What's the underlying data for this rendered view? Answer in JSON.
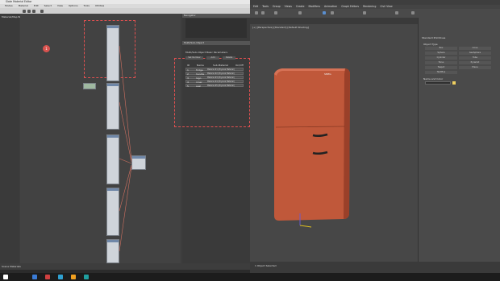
{
  "window": {
    "title": "Slate Material Editor",
    "max_title": "Untitled - Autodesk 3ds Max"
  },
  "sme_menu": [
    "Modes",
    "Material",
    "Edit",
    "Select",
    "View",
    "Options",
    "Tools",
    "Utilities"
  ],
  "max_menu": [
    "Edit",
    "Tools",
    "Group",
    "Views",
    "Create",
    "Modifiers",
    "Animation",
    "Graph Editors",
    "Rendering",
    "Civil View",
    "Customize",
    "Scripting",
    "Content",
    "Arnold",
    "Help"
  ],
  "panels": {
    "navigator": "Navigator",
    "params_title": "Multi/Sub-Object",
    "multisub": "Multi/Sub-Object Basic Parameters",
    "set_number": "Set Number",
    "add": "Add",
    "delete": "Delete",
    "cols": [
      "ID",
      "Name",
      "Sub-Material",
      "On/Off"
    ],
    "rows": [
      {
        "id": "1",
        "name": "fridge",
        "mat": "Material #1 (Physical Material)"
      },
      {
        "id": "2",
        "name": "handle",
        "mat": "Material #2 (Physical Material)"
      },
      {
        "id": "3",
        "name": "logo",
        "mat": "Material #3 (Physical Material)"
      },
      {
        "id": "4",
        "name": "inner",
        "mat": "Material #4 (Physical Material)"
      },
      {
        "id": "5",
        "name": "seal",
        "mat": "Material #5 (Physical Material)"
      }
    ]
  },
  "viewport_label": "[+] [Perspective] [Standard] [Default Shading]",
  "fridge_logo": "SMEG",
  "cmd": {
    "title": "Standard Primitives",
    "object_type": "Object Type",
    "name_color": "Name and Color",
    "buttons": [
      "Box",
      "Cone",
      "Sphere",
      "GeoSphere",
      "Cylinder",
      "Tube",
      "Torus",
      "Pyramid",
      "Teapot",
      "Plane",
      "TextPlus"
    ]
  },
  "callout": "1",
  "left_label": "Material/Map Browser",
  "bottom_left": "Scene Materials",
  "status": "1 Object Selected",
  "colors": {
    "fridge": "#c0583a",
    "wire": "#d07060",
    "dash": "#e05050"
  }
}
